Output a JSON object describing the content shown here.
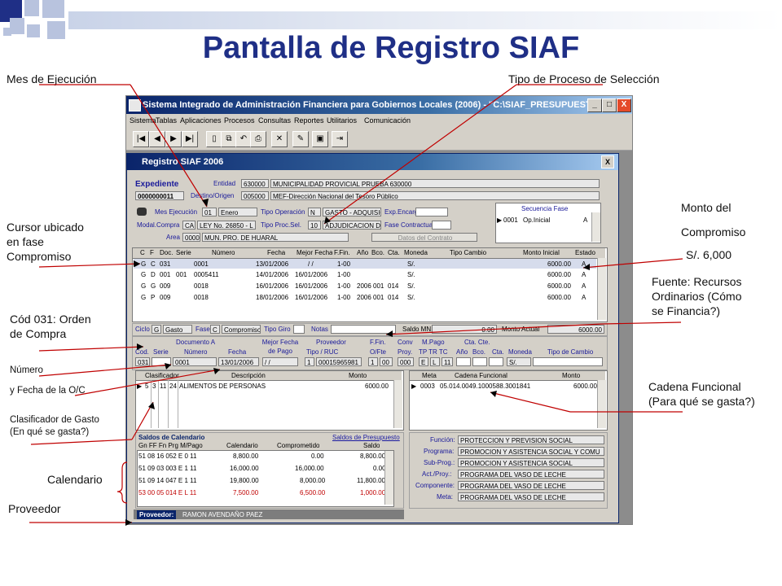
{
  "slide": {
    "title": "Pantalla de Registro SIAF",
    "colors": {
      "title": "#1f2f86",
      "squares_dark": "#1f2f86",
      "squares_light": "#b8c3de"
    }
  },
  "annotations": {
    "mes_ejecucion": "Mes de Ejecución",
    "tipo_proceso": "Tipo de Proceso de Selección",
    "monto_del": "Monto del",
    "compromiso": "Compromiso",
    "monto_valor": "S/. 6,000",
    "cursor_fase": [
      "Cursor ubicado",
      "en fase",
      "Compromiso"
    ],
    "fuente": [
      "Fuente: Recursos",
      "Ordinarios (Cómo",
      "se Financia?)"
    ],
    "cod_031": [
      "Cód 031: Orden",
      "de Compra"
    ],
    "numero": "Número",
    "fecha_oc": "y Fecha de la O/C",
    "clasificador": [
      "Clasificador de Gasto",
      "(En qué se gasta?)"
    ],
    "cadena": [
      "Cadena Funcional",
      "(Para qué se gasta?)"
    ],
    "calendario": "Calendario",
    "proveedor": "Proveedor"
  },
  "app": {
    "title": "Sistema Integrado de Administración Financiera para Gobiernos Locales (2006) - \"C:\\SIAF_PRESUPUESTO\"",
    "window_buttons": {
      "minimize": "_",
      "maximize": "□",
      "close": "X"
    },
    "menu": [
      "Sistema",
      "Tablas",
      "Aplicaciones",
      "Procesos",
      "Consultas",
      "Reportes",
      "Utilitarios",
      "Comunicación"
    ],
    "toolbar_icons": [
      "first-record-icon",
      "prev-record-icon",
      "next-record-icon",
      "last-record-icon",
      "new-document-icon",
      "copy-icon",
      "undo-icon",
      "print-icon",
      "delete-icon",
      "edit-icon",
      "save-icon",
      "exit-icon"
    ]
  },
  "dialog": {
    "title": "Registro SIAF 2006",
    "close": "X",
    "expediente": {
      "label": "Expediente",
      "value": "0000000011",
      "entidad_label": "Entidad",
      "entidad_code": "630000",
      "entidad_name": "MUNICIPALIDAD PROVICIAL PRUEBA 630000",
      "destino_label": "Destino/Origen",
      "destino_code": "005000",
      "destino_name": "MEF-Dirección Nacional del Tesoro Público"
    },
    "cabecera": {
      "mes_label": "Mes Ejecución",
      "mes_code": "01",
      "mes_name": "Enero",
      "tipo_op_label": "Tipo Operación",
      "tipo_op_code": "N",
      "tipo_op_name": "GASTO - ADQUISICION D",
      "exp_encargo_label": "Exp.Encargo",
      "modal_label": "Modal.Compra",
      "modal_code": "CA",
      "modal_name": "LEY No. 26850 - L",
      "tipo_proc_label": "Tipo Proc.Sel.",
      "tipo_proc_code": "10",
      "tipo_proc_name": "ADJUDICACION D",
      "fase_contr_label": "Fase Contractual",
      "area_label": "Area",
      "area_code": "0000",
      "area_name": "MUN. PRO. DE HUARAL",
      "datos_contrato": "Datos del Contrato"
    },
    "secuencia_fase": {
      "title": "Secuencia Fase",
      "row": [
        "0001",
        "Op.Inicial",
        "A"
      ]
    },
    "fases_table": {
      "headers": [
        "C",
        "F",
        "Doc.",
        "Serie",
        "Número",
        "Fecha",
        "Mejor Fecha",
        "F.Fin.",
        "Año",
        "Bco.",
        "Cta.",
        "Moneda",
        "Tipo Cambio",
        "Monto Inicial",
        "Estado"
      ],
      "rows": [
        [
          "G",
          "C",
          "031",
          "",
          "0001",
          "13/01/2006",
          "/ /",
          "1-00",
          "",
          "",
          "",
          "S/.",
          "",
          "6000.00",
          "A"
        ],
        [
          "G",
          "D",
          "001",
          "001",
          "0005411",
          "14/01/2006",
          "16/01/2006",
          "1-00",
          "",
          "",
          "",
          "S/.",
          "",
          "6000.00",
          "A"
        ],
        [
          "G",
          "G",
          "009",
          "",
          "0018",
          "16/01/2006",
          "16/01/2006",
          "1-00",
          "2006",
          "001",
          "014",
          "S/.",
          "",
          "6000.00",
          "A"
        ],
        [
          "G",
          "P",
          "009",
          "",
          "0018",
          "18/01/2006",
          "16/01/2006",
          "1-00",
          "2006",
          "001",
          "014",
          "S/.",
          "",
          "6000.00",
          "A"
        ]
      ]
    },
    "ciclo_bar": {
      "ciclo_label": "Ciclo",
      "ciclo_code": "G",
      "ciclo_name": "Gasto",
      "fase_label": "Fase",
      "fase_code": "C",
      "fase_name": "Compromiso",
      "tipo_giro_label": "Tipo Giro",
      "notas_label": "Notas",
      "saldo_mn_label": "Saldo MN",
      "saldo_mn_value": "0.00",
      "monto_actual_label": "Monto Actual",
      "monto_actual_value": "6000.00"
    },
    "documento": {
      "doc_a_header": "Documento A",
      "cod_label": "Cod.",
      "serie_label": "Serie",
      "numero_label": "Número",
      "fecha_label": "Fecha",
      "mejor_fecha_label": "Mejor Fecha de Pago",
      "proveedor_label": "Proveedor",
      "tipo_ruc_label": "Tipo / RUC",
      "ffin_label": "F.Fin.",
      "ofte_label": "O/Fte",
      "conv_label": "Conv",
      "proy_label": "Proy.",
      "mpago_label": "M.Pago",
      "tp_tr_tc_label": "TP TR TC",
      "cta_cte_label": "Cta. Cte.",
      "anio_label": "Año",
      "bco_label": "Bco.",
      "cta_label": "Cta.",
      "moneda_label": "Moneda",
      "tipo_cambio_label": "Tipo de Cambio",
      "cod": "031",
      "numero": "0001",
      "fecha": "13/01/2006",
      "mejor_fecha": "/ /",
      "tipo": "1",
      "ruc": "00015965981",
      "ffin": "1",
      "ofte": "00",
      "proy": "000",
      "tp": "E",
      "tr": "L",
      "tc": "11",
      "moneda": "S/."
    },
    "clasificador_grid": {
      "headers": [
        "Clasificador",
        "Descripción",
        "Monto"
      ],
      "row": [
        "5",
        "3",
        "11",
        "24",
        "ALIMENTOS DE PERSONAS",
        "6000.00"
      ]
    },
    "meta_grid": {
      "headers": [
        "Meta",
        "Cadena Funcional",
        "Monto"
      ],
      "row": [
        "0003",
        "05.014.0049.1000588.3001841",
        "6000.00"
      ]
    },
    "saldos": {
      "title": "Saldos de Calendario",
      "link": "Saldos de Presupuesto",
      "headers": [
        "Gn FF Fn Prg M/Pago",
        "Calendario",
        "Comprometido",
        "Saldo"
      ],
      "rows": [
        {
          "code": "51 08 16 052 E 0 11",
          "cal": "8,800.00",
          "comp": "0.00",
          "saldo": "8,800.00",
          "red": false
        },
        {
          "code": "51 09 03 003 E 1 11",
          "cal": "16,000.00",
          "comp": "16,000.00",
          "saldo": "0.00",
          "red": false
        },
        {
          "code": "51 09 14 047 E 1 11",
          "cal": "19,800.00",
          "comp": "8,000.00",
          "saldo": "11,800.00",
          "red": false
        },
        {
          "code": "53 00 05 014 E L 11",
          "cal": "7,500.00",
          "comp": "6,500.00",
          "saldo": "1,000.00",
          "red": true
        }
      ],
      "red_color": "#c00000"
    },
    "funcional": {
      "funcion_label": "Función:",
      "funcion": "PROTECCION Y PREVISION SOCIAL",
      "programa_label": "Programa:",
      "programa": "PROMOCION Y ASISTENCIA SOCIAL Y COMU",
      "subprog_label": "Sub-Prog.:",
      "subprog": "PROMOCION Y ASISTENCIA SOCIAL",
      "actproy_label": "Act./Proy.:",
      "actproy": "PROGRAMA DEL VASO DE LECHE",
      "componente_label": "Componente:",
      "componente": "PROGRAMA DEL VASO DE LECHE",
      "meta_label": "Meta:",
      "meta": "PROGRAMA DEL VASO DE LECHE"
    },
    "proveedor_bar": {
      "label": "Proveedor:",
      "value": "RAMON AVENDAÑO PAEZ"
    }
  }
}
